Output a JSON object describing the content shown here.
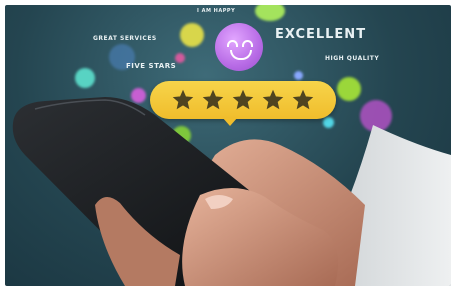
{
  "labels": {
    "happy": "I AM HAPPY",
    "great_services": "GREAT SERVICES",
    "excellent": "EXCELLENT",
    "five_stars": "FIVE STARS",
    "high_quality": "HIGH QUALITY"
  },
  "rating": {
    "stars": 5,
    "max": 5
  },
  "icons": [
    "smiley-face-icon",
    "star-icon"
  ],
  "colors": {
    "star_bubble": "#f0bd2c",
    "smiley": "#b86ce6",
    "background": "#244550"
  }
}
